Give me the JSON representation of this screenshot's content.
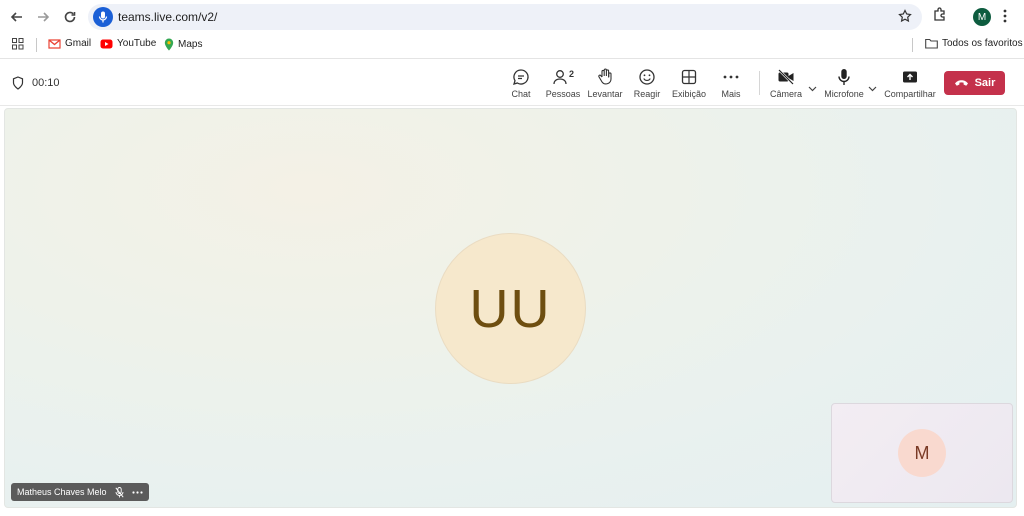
{
  "browser": {
    "url": "teams.live.com/v2/",
    "profile_initial": "M",
    "bookmarks": [
      {
        "label": "Gmail"
      },
      {
        "label": "YouTube"
      },
      {
        "label": "Maps"
      }
    ],
    "bookmarks_folder": "Todos os favoritos"
  },
  "meeting": {
    "timer": "00:10",
    "toolbar": {
      "chat": "Chat",
      "people": "Pessoas",
      "people_count": "2",
      "raise": "Levantar",
      "react": "Reagir",
      "view": "Exibição",
      "more": "Mais",
      "camera": "Câmera",
      "mic": "Microfone",
      "share": "Compartilhar",
      "leave": "Sair"
    },
    "main_participant": {
      "initials": "UU"
    },
    "name_tag": "Matheus Chaves Melo",
    "self_view": {
      "initial": "M"
    }
  },
  "colors": {
    "leave_button": "#c4314b",
    "main_avatar_bg": "#f6e8cc",
    "self_avatar_bg": "#f9d9cf",
    "profile_bg": "#0d5c3f"
  }
}
